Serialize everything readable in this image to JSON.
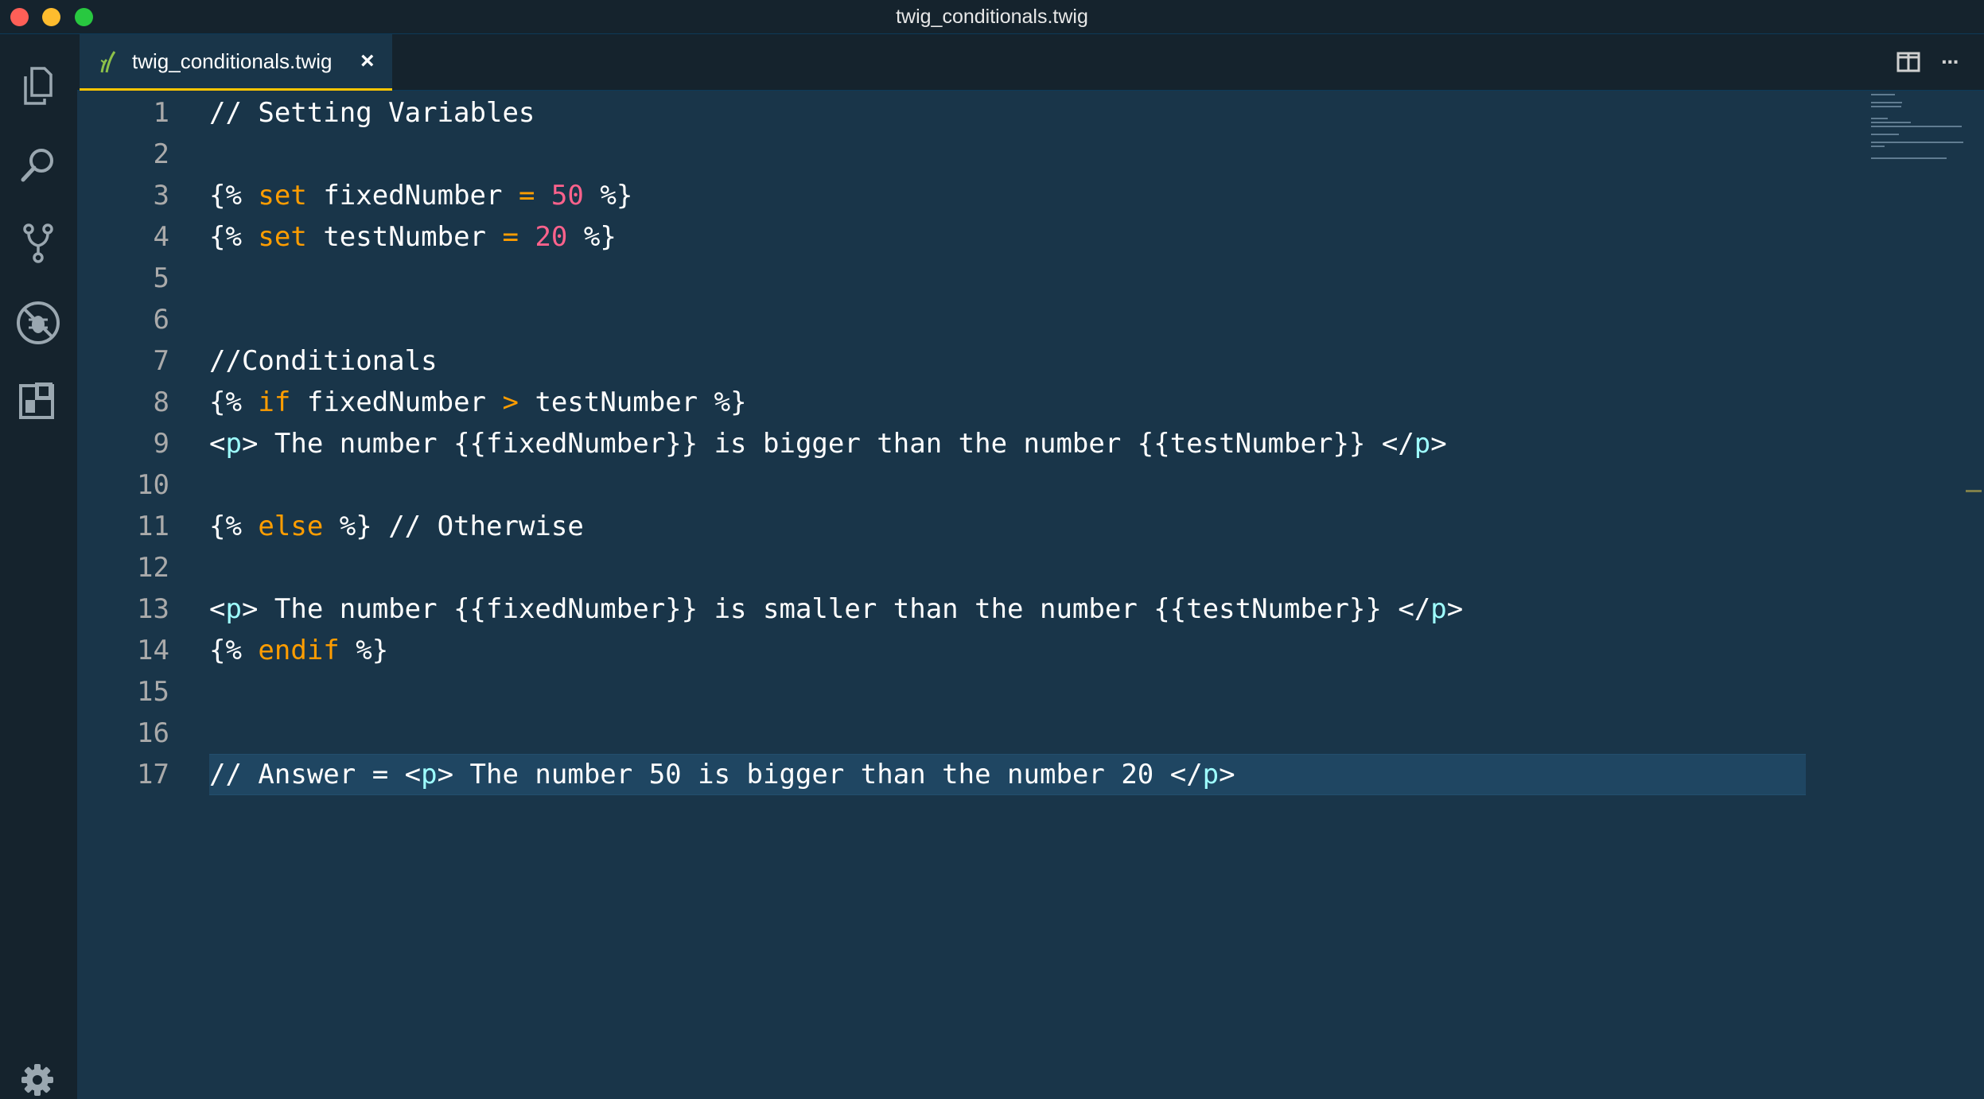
{
  "window": {
    "title": "twig_conditionals.twig"
  },
  "activity_bar": {
    "items": [
      {
        "name": "explorer-icon"
      },
      {
        "name": "search-icon"
      },
      {
        "name": "source-control-icon"
      },
      {
        "name": "debug-icon"
      },
      {
        "name": "extensions-icon"
      }
    ],
    "footer_icon": "gear-icon"
  },
  "tabs": [
    {
      "label": "twig_conditionals.twig",
      "close_glyph": "×",
      "active": true,
      "icon": "twig-file-icon"
    }
  ],
  "tab_actions": {
    "split_icon": "split-editor-icon",
    "more_glyph": "···"
  },
  "editor": {
    "current_line": 17,
    "lines": [
      {
        "num": "1",
        "tokens": [
          {
            "t": "comment",
            "v": "// Setting Variables"
          }
        ]
      },
      {
        "num": "2",
        "tokens": []
      },
      {
        "num": "3",
        "tokens": [
          {
            "t": "plain",
            "v": "{% "
          },
          {
            "t": "keyword",
            "v": "set"
          },
          {
            "t": "plain",
            "v": " fixedNumber "
          },
          {
            "t": "operator",
            "v": "="
          },
          {
            "t": "plain",
            "v": " "
          },
          {
            "t": "number",
            "v": "50"
          },
          {
            "t": "plain",
            "v": " %}"
          }
        ]
      },
      {
        "num": "4",
        "tokens": [
          {
            "t": "plain",
            "v": "{% "
          },
          {
            "t": "keyword",
            "v": "set"
          },
          {
            "t": "plain",
            "v": " testNumber "
          },
          {
            "t": "operator",
            "v": "="
          },
          {
            "t": "plain",
            "v": " "
          },
          {
            "t": "number",
            "v": "20"
          },
          {
            "t": "plain",
            "v": " %}"
          }
        ]
      },
      {
        "num": "5",
        "tokens": []
      },
      {
        "num": "6",
        "tokens": []
      },
      {
        "num": "7",
        "tokens": [
          {
            "t": "comment",
            "v": "//Conditionals"
          }
        ]
      },
      {
        "num": "8",
        "tokens": [
          {
            "t": "plain",
            "v": "{% "
          },
          {
            "t": "keyword",
            "v": "if"
          },
          {
            "t": "plain",
            "v": " fixedNumber "
          },
          {
            "t": "operator",
            "v": ">"
          },
          {
            "t": "plain",
            "v": " testNumber %}"
          }
        ]
      },
      {
        "num": "9",
        "tokens": [
          {
            "t": "plain",
            "v": "<"
          },
          {
            "t": "tag",
            "v": "p"
          },
          {
            "t": "plain",
            "v": "> The number {{fixedNumber}} is bigger than the number {{testNumber}} </"
          },
          {
            "t": "tag",
            "v": "p"
          },
          {
            "t": "plain",
            "v": ">"
          }
        ]
      },
      {
        "num": "10",
        "tokens": []
      },
      {
        "num": "11",
        "tokens": [
          {
            "t": "plain",
            "v": "{% "
          },
          {
            "t": "keyword",
            "v": "else"
          },
          {
            "t": "plain",
            "v": " %} // Otherwise"
          }
        ]
      },
      {
        "num": "12",
        "tokens": []
      },
      {
        "num": "13",
        "tokens": [
          {
            "t": "plain",
            "v": "<"
          },
          {
            "t": "tag",
            "v": "p"
          },
          {
            "t": "plain",
            "v": "> The number {{fixedNumber}} is smaller than the number {{testNumber}} </"
          },
          {
            "t": "tag",
            "v": "p"
          },
          {
            "t": "plain",
            "v": ">"
          }
        ]
      },
      {
        "num": "14",
        "tokens": [
          {
            "t": "plain",
            "v": "{% "
          },
          {
            "t": "keyword",
            "v": "endif"
          },
          {
            "t": "plain",
            "v": " %}"
          }
        ]
      },
      {
        "num": "15",
        "tokens": []
      },
      {
        "num": "16",
        "tokens": []
      },
      {
        "num": "17",
        "tokens": [
          {
            "t": "comment",
            "v": "// Answer = <"
          },
          {
            "t": "tag",
            "v": "p"
          },
          {
            "t": "plain",
            "v": "> The number 50 is bigger than the number 20 </"
          },
          {
            "t": "tag",
            "v": "p"
          },
          {
            "t": "plain",
            "v": ">"
          }
        ]
      }
    ]
  },
  "colors": {
    "background": "#193549",
    "chrome": "#15232d",
    "accent": "#ffc600",
    "keyword": "#ff9d00",
    "number": "#ff628c",
    "tag": "#9effff",
    "line_number": "#aaaaaa"
  }
}
